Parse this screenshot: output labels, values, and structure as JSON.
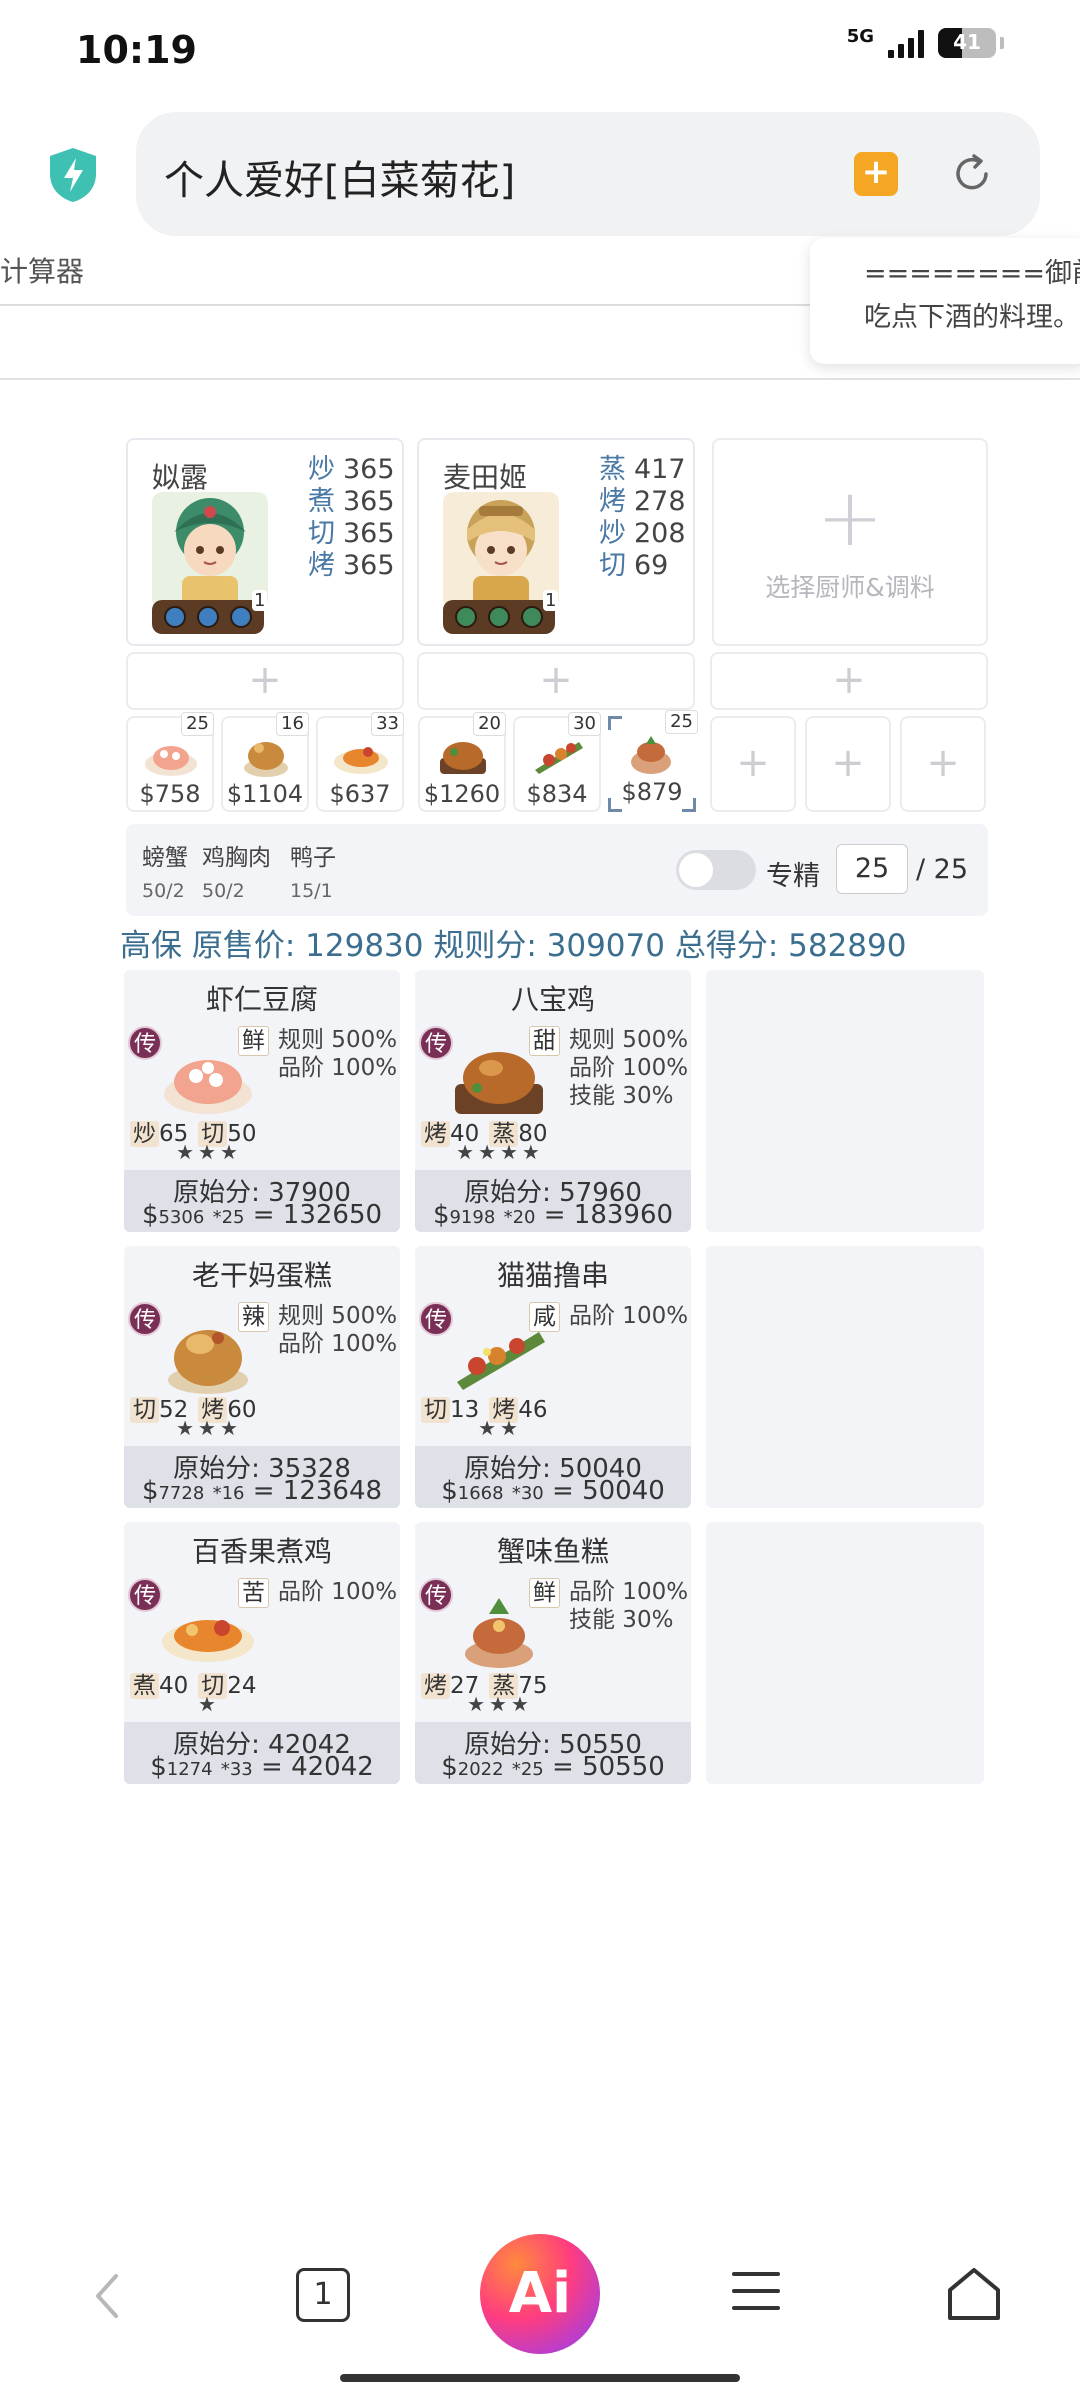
{
  "status_bar": {
    "time": "10:19",
    "network": "5G",
    "battery": "41"
  },
  "browser": {
    "url_title": "个人爱好[白菜菊花]"
  },
  "page": {
    "calculator_title": "计算器",
    "popup_line1": "========御前大",
    "popup_line2": "吃点下酒的料理。"
  },
  "chefs": [
    {
      "name": "姒露",
      "level": "1",
      "skills": [
        {
          "label": "炒",
          "value": "365"
        },
        {
          "label": "煮",
          "value": "365"
        },
        {
          "label": "切",
          "value": "365"
        },
        {
          "label": "烤",
          "value": "365"
        }
      ]
    },
    {
      "name": "麦田姬",
      "level": "1",
      "skills": [
        {
          "label": "蒸",
          "value": "417"
        },
        {
          "label": "烤",
          "value": "278"
        },
        {
          "label": "炒",
          "value": "208"
        },
        {
          "label": "切",
          "value": "69"
        }
      ]
    }
  ],
  "empty_chef": {
    "plus": "+",
    "label": "选择厨师&调料"
  },
  "equip_slots": [
    "+",
    "+",
    "+"
  ],
  "dish_slots": [
    {
      "count": "25",
      "price": "$758"
    },
    {
      "count": "16",
      "price": "$1104"
    },
    {
      "count": "33",
      "price": "$637"
    },
    {
      "count": "20",
      "price": "$1260"
    },
    {
      "count": "30",
      "price": "$834"
    },
    {
      "count": "25",
      "price": "$879"
    }
  ],
  "empty_dish_slots": [
    "+",
    "+",
    "+"
  ],
  "materials": [
    {
      "name": "螃蟹",
      "qty": "50/2"
    },
    {
      "name": "鸡胸肉",
      "qty": "50/2"
    },
    {
      "name": "鸭子",
      "qty": "15/1"
    }
  ],
  "specialize": {
    "label": "专精",
    "value": "25",
    "total": "/ 25",
    "enabled": false
  },
  "summary": "高保 原售价: 129830 规则分: 309070 总得分: 582890",
  "recipes": [
    {
      "name": "虾仁豆腐",
      "rarity": "传",
      "taste": "鲜",
      "bonuses": [
        "规则 500%",
        "品阶 100%"
      ],
      "skills": [
        {
          "label": "炒",
          "value": "65"
        },
        {
          "label": "切",
          "value": "50"
        }
      ],
      "stars": "★★★",
      "raw_score": "原始分: 37900",
      "calc_price": "5306",
      "calc_mult": "*25",
      "calc_total": "132650"
    },
    {
      "name": "八宝鸡",
      "rarity": "传",
      "taste": "甜",
      "bonuses": [
        "规则 500%",
        "品阶 100%",
        "技能 30%"
      ],
      "skills": [
        {
          "label": "烤",
          "value": "40"
        },
        {
          "label": "蒸",
          "value": "80"
        }
      ],
      "stars": "★★★★",
      "raw_score": "原始分: 57960",
      "calc_price": "9198",
      "calc_mult": "*20",
      "calc_total": "183960"
    },
    {
      "name": "老干妈蛋糕",
      "rarity": "传",
      "taste": "辣",
      "bonuses": [
        "规则 500%",
        "品阶 100%"
      ],
      "skills": [
        {
          "label": "切",
          "value": "52"
        },
        {
          "label": "烤",
          "value": "60"
        }
      ],
      "stars": "★★★",
      "raw_score": "原始分: 35328",
      "calc_price": "7728",
      "calc_mult": "*16",
      "calc_total": "123648"
    },
    {
      "name": "猫猫撸串",
      "rarity": "传",
      "taste": "咸",
      "bonuses": [
        "品阶 100%"
      ],
      "skills": [
        {
          "label": "切",
          "value": "13"
        },
        {
          "label": "烤",
          "value": "46"
        }
      ],
      "stars": "★★",
      "raw_score": "原始分: 50040",
      "calc_price": "1668",
      "calc_mult": "*30",
      "calc_total": "50040"
    },
    {
      "name": "百香果煮鸡",
      "rarity": "传",
      "taste": "苦",
      "bonuses": [
        "品阶 100%"
      ],
      "skills": [
        {
          "label": "煮",
          "value": "40"
        },
        {
          "label": "切",
          "value": "24"
        }
      ],
      "stars": "★",
      "raw_score": "原始分: 42042",
      "calc_price": "1274",
      "calc_mult": "*33",
      "calc_total": "42042"
    },
    {
      "name": "蟹味鱼糕",
      "rarity": "传",
      "taste": "鲜",
      "bonuses": [
        "品阶 100%",
        "技能 30%"
      ],
      "skills": [
        {
          "label": "烤",
          "value": "27"
        },
        {
          "label": "蒸",
          "value": "75"
        }
      ],
      "stars": "★★★",
      "raw_score": "原始分: 50550",
      "calc_price": "2022",
      "calc_mult": "*25",
      "calc_total": "50550"
    }
  ],
  "bottom_nav": {
    "tabs_count": "1",
    "ai_label": "Ai"
  },
  "colors": {
    "accent_blue": "#4a79a5",
    "summary_teal": "#3b6e8f",
    "legend_badge": "#7a2f56",
    "shield": "#3ec1b3",
    "bookmark": "#f5a623"
  }
}
